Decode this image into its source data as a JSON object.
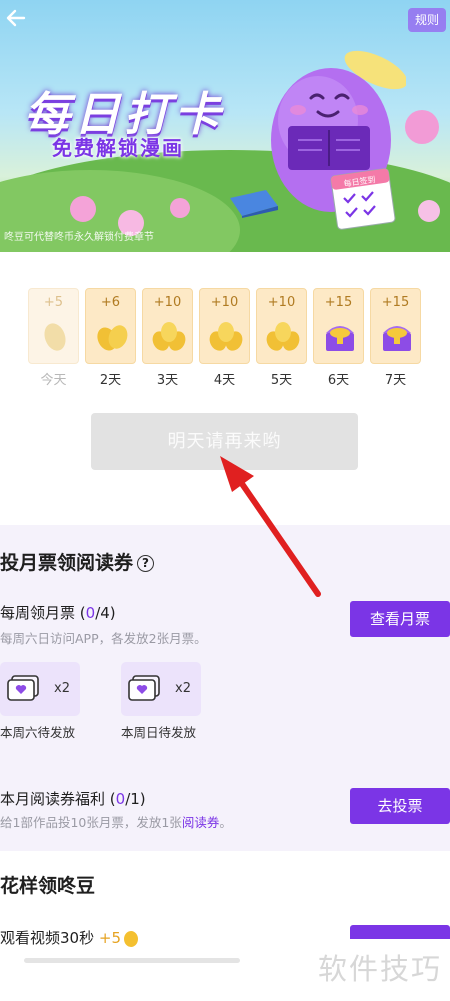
{
  "header": {
    "back_icon": "arrow-left-icon",
    "rules_label": "规则"
  },
  "banner": {
    "title": "每日打卡",
    "subtitle": "免费解锁漫画",
    "note": "咚豆可代替咚币永久解锁付费章节",
    "calendar_label": "每日签到"
  },
  "checkin": {
    "days": [
      {
        "amount": "+5",
        "label": "今天",
        "icon": "bean-icon",
        "today": true
      },
      {
        "amount": "+6",
        "label": "2天",
        "icon": "beans-icon",
        "today": false
      },
      {
        "amount": "+10",
        "label": "3天",
        "icon": "beans-pile-icon",
        "today": false
      },
      {
        "amount": "+10",
        "label": "4天",
        "icon": "beans-pile-icon",
        "today": false
      },
      {
        "amount": "+10",
        "label": "5天",
        "icon": "beans-pile-icon",
        "today": false
      },
      {
        "amount": "+15",
        "label": "6天",
        "icon": "treasure-chest-icon",
        "today": false
      },
      {
        "amount": "+15",
        "label": "7天",
        "icon": "treasure-chest-icon",
        "today": false
      }
    ],
    "button_label": "明天请再来哟"
  },
  "monthly_ticket": {
    "section_title": "投月票领阅读券",
    "weekly": {
      "title": "每周领月票",
      "progress_open": "(",
      "progress_value": "0",
      "progress_rest": "/4)",
      "desc": "每周六日访问APP，各发放2张月票。",
      "button_label": "查看月票",
      "tickets": [
        {
          "multiplier": "x2",
          "label": "本周六待发放"
        },
        {
          "multiplier": "x2",
          "label": "本周日待发放"
        }
      ]
    },
    "monthly": {
      "title": "本月阅读券福利",
      "progress_open": "(",
      "progress_value": "0",
      "progress_rest": "/1)",
      "desc_prefix": "给1部作品投10张月票，发放1张",
      "desc_accent": "阅读券",
      "desc_suffix": "。",
      "button_label": "去投票"
    }
  },
  "beans": {
    "section_title": "花样领咚豆",
    "task_title": "观看视频30秒",
    "reward": "+5"
  },
  "watermark": "软件技巧",
  "colors": {
    "accent": "#7b35e6",
    "day_card": "#fde9c6",
    "disabled_button": "#e2e2e2",
    "annotation_arrow": "#e02020"
  }
}
